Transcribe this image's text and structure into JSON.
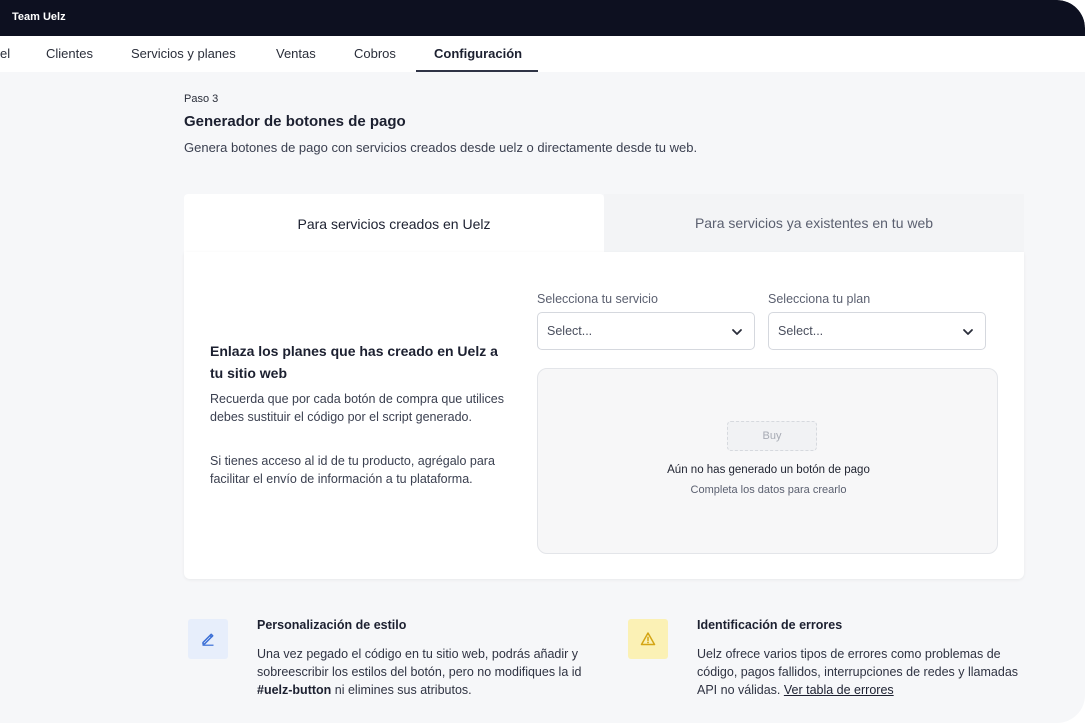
{
  "app": {
    "title": "Team Uelz"
  },
  "nav": {
    "tabs": [
      {
        "label": "el"
      },
      {
        "label": "Clientes"
      },
      {
        "label": "Servicios y planes"
      },
      {
        "label": "Ventas"
      },
      {
        "label": "Cobros"
      },
      {
        "label": "Configuración"
      }
    ],
    "active": "Configuración"
  },
  "page": {
    "step": "Paso 3",
    "title": "Generador de botones de pago",
    "subtitle": "Genera botones de pago con servicios creados desde uelz o directamente desde tu web."
  },
  "mode_tabs": [
    {
      "label": "Para servicios creados en Uelz",
      "selected": true
    },
    {
      "label": "Para servicios ya existentes en tu web",
      "selected": false
    }
  ],
  "card": {
    "heading": "Enlaza los planes que has creado en Uelz a tu sitio web",
    "para1": "Recuerda que por cada botón de compra que utilices debes sustituir el código por el script generado.",
    "para2": "Si tienes acceso al id de tu producto, agrégalo para facilitar el envío de información a tu plataforma.",
    "service_select": {
      "label": "Selecciona tu servicio",
      "value": "Select..."
    },
    "plan_select": {
      "label": "Selecciona tu plan",
      "value": "Select..."
    },
    "preview": {
      "button_label": "Buy",
      "title": "Aún no has generado un botón de pago",
      "subtitle": "Completa los datos para crearlo"
    }
  },
  "features": {
    "style": {
      "icon": "edit-icon",
      "title": "Personalización de estilo",
      "text_before": "Una vez pegado el código en tu sitio web, podrás añadir y sobreescribir los estilos del botón, pero no modifiques la id ",
      "code": "#uelz-button",
      "text_after": " ni elimines sus atributos."
    },
    "errors": {
      "icon": "warning-icon",
      "title": "Identificación de errores",
      "text": "Uelz ofrece varios tipos de errores como problemas de código, pagos fallidos, interrupciones de redes y llamadas API no válidas. ",
      "link": "Ver tabla de errores"
    }
  },
  "colors": {
    "topbar": "#0d1020",
    "edit_icon_bg": "#e7eefb",
    "edit_icon": "#3b6fd6",
    "warning_icon_bg": "#fbf1b5",
    "warning_icon": "#d4a514"
  }
}
